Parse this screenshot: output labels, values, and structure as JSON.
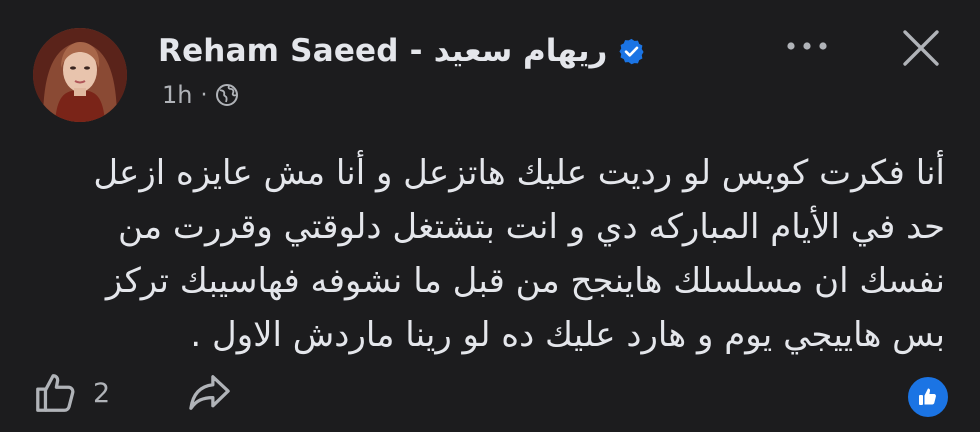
{
  "post": {
    "author": {
      "name": "Reham Saeed - ريهام  سعيد",
      "verified": true
    },
    "meta": {
      "time": "1h",
      "separator": "·",
      "privacy_icon": "globe-icon"
    },
    "text_lines": [
      "أنا فكرت كويس لو رديت عليك هاتزعل و أنا مش عايزه ازعل",
      "حد في الأيام المباركه دي و انت بتشتغل دلوقتي وقررت من",
      "نفسك ان مسلسلك هاينجح من قبل ما نشوفه فهاسيبك تركز",
      "بس هاييجي يوم و هارد عليك ده لو رينا ماردش الاول ."
    ],
    "actions": {
      "like_count": "2",
      "like_icon": "thumbs-up-icon",
      "share_icon": "share-icon"
    },
    "header_buttons": {
      "more_icon": "more-dots-icon",
      "close_icon": "close-icon"
    },
    "colors": {
      "background": "#1c1c1e",
      "text_primary": "#e4e6eb",
      "text_secondary": "#b0b3b8",
      "accent": "#1b74e4"
    }
  }
}
